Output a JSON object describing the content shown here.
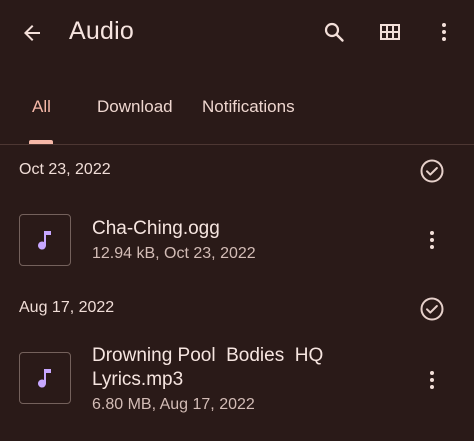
{
  "appbar": {
    "title": "Audio",
    "icons": {
      "back": "arrow-back-icon",
      "search": "search-icon",
      "grid": "grid-view-icon",
      "more": "more-vert-icon"
    }
  },
  "tabs": [
    {
      "label": "All",
      "active": true
    },
    {
      "label": "Download",
      "active": false
    },
    {
      "label": "Notifications",
      "active": false
    }
  ],
  "sections": [
    {
      "date": "Oct 23, 2022",
      "files": [
        {
          "name": "Cha-Ching.ogg",
          "meta": "12.94 kB, Oct 23, 2022",
          "icon": "music-note-icon"
        }
      ]
    },
    {
      "date": "Aug 17, 2022",
      "files": [
        {
          "name": "Drowning Pool  Bodies  HQ\nLyrics.mp3",
          "meta": "6.80 MB, Aug 17, 2022",
          "icon": "music-note-icon"
        }
      ]
    }
  ],
  "colors": {
    "background": "#2a1a18",
    "accent": "#f6b8a8",
    "music_icon": "#c7a7ff"
  }
}
